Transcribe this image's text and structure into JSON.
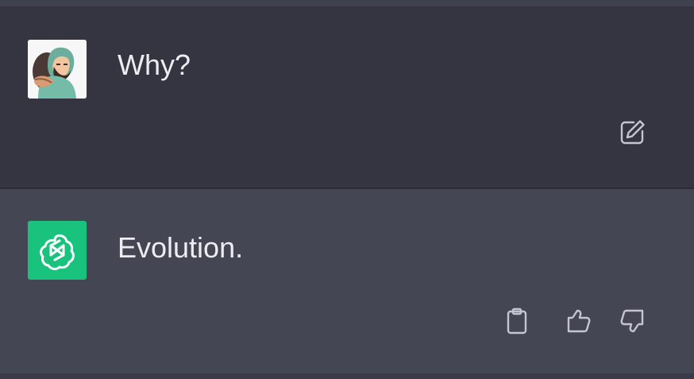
{
  "conversation": {
    "user_message": {
      "text": "Why?",
      "avatar_icon": "user-avatar-cartoon-hooded-man",
      "actions": [
        {
          "icon": "edit-icon"
        }
      ]
    },
    "assistant_message": {
      "text": "Evolution.",
      "avatar_icon": "openai-logo-icon",
      "actions": [
        {
          "icon": "clipboard-icon"
        },
        {
          "icon": "thumbs-up-icon"
        },
        {
          "icon": "thumbs-down-icon"
        }
      ]
    }
  },
  "colors": {
    "background": "#343541",
    "assistant_background": "#444654",
    "text": "#ECECF1",
    "icon": "#C5C5D2",
    "assistant_avatar": "#19C37D"
  }
}
